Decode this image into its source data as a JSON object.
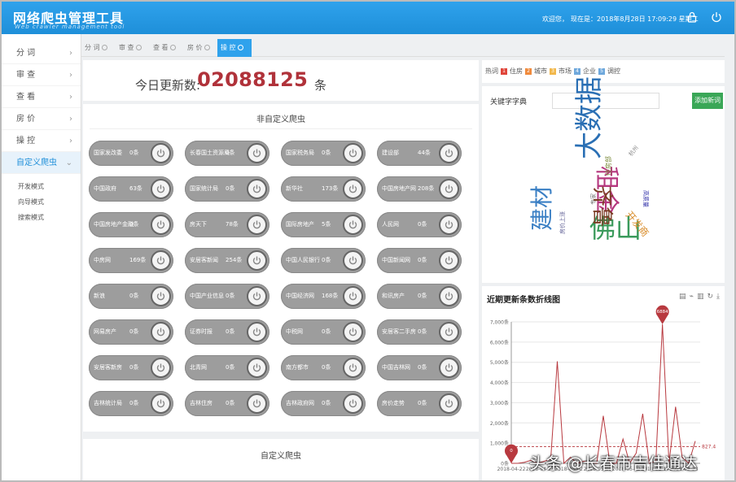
{
  "header": {
    "title": "网络爬虫管理工具",
    "subtitle": "Web crawler management tool",
    "welcome": "欢迎您，",
    "datetime": "现在是：2018年8月28日 17:09:29 星期二",
    "icons": [
      "lock-icon",
      "power-icon"
    ]
  },
  "sidebar": {
    "items": [
      {
        "label": "分  词"
      },
      {
        "label": "审  查"
      },
      {
        "label": "查  看"
      },
      {
        "label": "房  价"
      },
      {
        "label": "操  控"
      },
      {
        "label": "自定义爬虫"
      }
    ],
    "subitems": [
      "开发模式",
      "向导模式",
      "搜索模式"
    ]
  },
  "tabs": [
    "分  词",
    "审  查",
    "查  看",
    "房  价",
    "操  控"
  ],
  "counter": {
    "label": "今日更新数:",
    "digits": [
      "0",
      "2",
      "0",
      "8",
      "8",
      "1",
      "2",
      "5"
    ],
    "unit": "条"
  },
  "non_custom": {
    "title": "非自定义爬虫",
    "crawlers": [
      {
        "name": "国家发改委",
        "count": "0条"
      },
      {
        "name": "长春国土资源局",
        "count": "0条"
      },
      {
        "name": "国家税务局",
        "count": "0条"
      },
      {
        "name": "建设部",
        "count": "44条"
      },
      {
        "name": "中国政府",
        "count": "63条"
      },
      {
        "name": "国家统计局",
        "count": "0条"
      },
      {
        "name": "新华社",
        "count": "173条"
      },
      {
        "name": "中国房地产网",
        "count": "208条"
      },
      {
        "name": "中国房地产金融",
        "count": "0条"
      },
      {
        "name": "房天下",
        "count": "78条"
      },
      {
        "name": "国际房地产",
        "count": "5条"
      },
      {
        "name": "人民网",
        "count": "0条"
      },
      {
        "name": "中房网",
        "count": "169条"
      },
      {
        "name": "安居客新闻",
        "count": "254条"
      },
      {
        "name": "中国人民银行",
        "count": "0条"
      },
      {
        "name": "中国新闻网",
        "count": "0条"
      },
      {
        "name": "新浪",
        "count": "0条"
      },
      {
        "name": "中国产业信息",
        "count": "0条"
      },
      {
        "name": "中国经济网",
        "count": "168条"
      },
      {
        "name": "和讯房产",
        "count": "0条"
      },
      {
        "name": "网易房产",
        "count": "0条"
      },
      {
        "name": "证券时报",
        "count": "0条"
      },
      {
        "name": "中税网",
        "count": "0条"
      },
      {
        "name": "安居客二手房",
        "count": "0条"
      },
      {
        "name": "安居客新房",
        "count": "0条"
      },
      {
        "name": "北青网",
        "count": "0条"
      },
      {
        "name": "南方都市",
        "count": "0条"
      },
      {
        "name": "中国吉林网",
        "count": "0条"
      },
      {
        "name": "吉林统计局",
        "count": "0条"
      },
      {
        "name": "吉林住房",
        "count": "0条"
      },
      {
        "name": "吉林政府网",
        "count": "0条"
      },
      {
        "name": "房价走势",
        "count": "0条"
      }
    ]
  },
  "custom": {
    "title": "自定义爬虫"
  },
  "hot": {
    "label": "热词",
    "items": [
      {
        "num": "1",
        "label": "住房",
        "color": "#e0453a"
      },
      {
        "num": "2",
        "label": "城市",
        "color": "#f08a3c"
      },
      {
        "num": "3",
        "label": "市场",
        "color": "#f2b84b"
      },
      {
        "num": "4",
        "label": "企业",
        "color": "#6fa8dc"
      },
      {
        "num": "5",
        "label": "调控",
        "color": "#6fa8dc"
      }
    ]
  },
  "keywords": {
    "label": "关键字字典",
    "add_button": "添加新词",
    "words": [
      {
        "text": "大数据",
        "color": "#2a6fb4"
      },
      {
        "text": "建材",
        "color": "#3a7fc4"
      },
      {
        "text": "佛山",
        "color": "#3a9a5b"
      },
      {
        "text": "租金",
        "color": "#b5377e"
      },
      {
        "text": "齐鲁",
        "color": "#7b3d25"
      },
      {
        "text": "开发商",
        "color": "#d98c2a"
      },
      {
        "text": "住房部",
        "color": "#7a8a3a"
      },
      {
        "text": "房价上涨",
        "color": "#666699"
      },
      {
        "text": "杭州",
        "color": "#888888"
      },
      {
        "text": "专家",
        "color": "#777777"
      },
      {
        "text": "高质量",
        "color": "#3333aa"
      }
    ]
  },
  "chart_data": {
    "type": "line",
    "title": "近期更新条数折线图",
    "tools": [
      "data-view-icon",
      "line-icon",
      "bar-icon",
      "refresh-icon",
      "download-icon"
    ],
    "x_tick_labels": [
      "2018-04-22",
      "2018-04-27",
      "2018-05-02",
      "2018-05-07",
      "2018-05-12",
      "2018-08-17",
      "2018-08-23"
    ],
    "y_tick_labels": [
      "0条",
      "1,000条",
      "2,000条",
      "3,000条",
      "4,000条",
      "5,000条",
      "6,000条",
      "7,000条"
    ],
    "ylim": [
      0,
      7000
    ],
    "values": [
      0,
      0,
      50,
      150,
      0,
      100,
      200,
      5050,
      0,
      300,
      0,
      100,
      50,
      0,
      2350,
      0,
      0,
      1200,
      0,
      500,
      2450,
      0,
      100,
      6884,
      0,
      2800,
      300,
      0,
      1100
    ],
    "max_label": "6884",
    "min_label": "0",
    "avg_label": "827.4",
    "avg_value": 827.4,
    "color": "#b8393f"
  },
  "watermark": "头条 @长春市吉佳通达"
}
